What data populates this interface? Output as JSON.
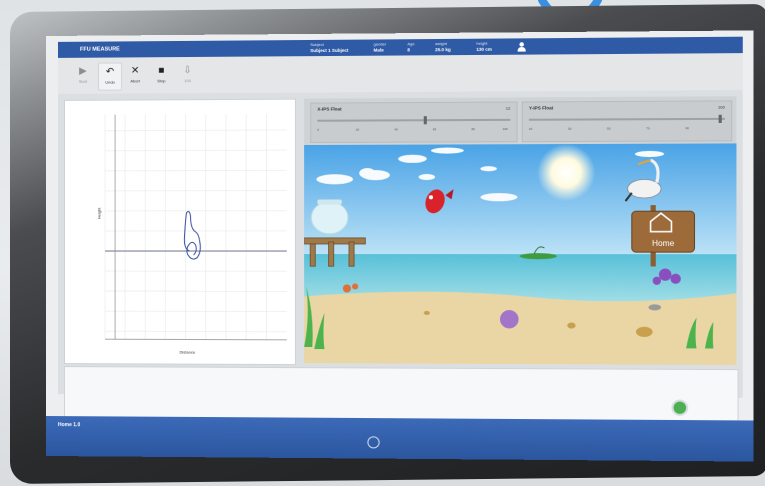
{
  "app": {
    "title": "FFU MEASURE",
    "version": "Home 1.0"
  },
  "header_info": [
    {
      "label": "Subject",
      "value": "Subject 1 Subject"
    },
    {
      "label": "gender",
      "value": "Male"
    },
    {
      "label": "Age",
      "value": "8"
    },
    {
      "label": "weight",
      "value": "25.0 kg"
    },
    {
      "label": "height",
      "value": "130 cm"
    }
  ],
  "toolbar": {
    "start_label": "Start",
    "undo_label": "Undo",
    "abort_label": "Abort",
    "stop_label": "Stop",
    "extra_label": "100"
  },
  "graph": {
    "x_label": "Distance",
    "y_label": "Height"
  },
  "sliders": {
    "left_title": "X-IPS Float",
    "left_value": "12",
    "right_title": "Y-IPS Float",
    "right_value": "100",
    "ticks": [
      "0",
      "10",
      "20",
      "30",
      "40",
      "50",
      "60",
      "70",
      "80",
      "90",
      "100"
    ]
  },
  "scene": {
    "sign_text": "Home",
    "colors": {
      "sky": "#6db7ea",
      "sea": "#5fc3d9",
      "sand": "#ead6a4"
    }
  },
  "colors": {
    "accent": "#2e5aa6",
    "go": "#4cb050"
  }
}
